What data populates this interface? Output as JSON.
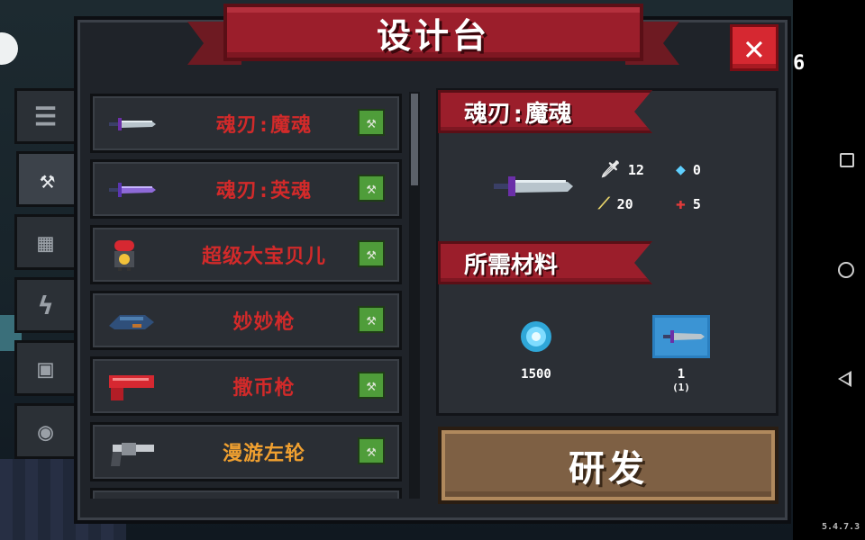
{
  "title": "设计台",
  "close_label": "✕",
  "gem_count": "6",
  "version": "5.4.7.3",
  "colors": {
    "name_red": "#d22a2a",
    "name_orange": "#f0a030",
    "ribbon": "#9b1e2b",
    "button": "#7e6044"
  },
  "side_tabs": [
    {
      "icon": "list-icon",
      "glyph": "☰"
    },
    {
      "icon": "weapon-tab-icon",
      "glyph": "⚒"
    },
    {
      "icon": "armor-tab-icon",
      "glyph": "▦"
    },
    {
      "icon": "lightning-tab-icon",
      "glyph": "ϟ"
    },
    {
      "icon": "items-tab-icon",
      "glyph": "▣"
    },
    {
      "icon": "pet-tab-icon",
      "glyph": "◉"
    }
  ],
  "weapon_list": [
    {
      "name": "魂刃:魔魂",
      "icon": "soul-blade-demon-icon",
      "craft_icon": "hammer-icon"
    },
    {
      "name": "魂刃:英魂",
      "icon": "soul-blade-hero-icon",
      "craft_icon": "hammer-icon"
    },
    {
      "name": "超级大宝贝儿",
      "icon": "big-baby-bomb-icon",
      "craft_icon": "hammer-icon"
    },
    {
      "name": "妙妙枪",
      "icon": "wonder-gun-icon",
      "craft_icon": "hammer-icon"
    },
    {
      "name": "撒币枪",
      "icon": "coin-gun-icon",
      "craft_icon": "hammer-icon"
    },
    {
      "name": "漫游左轮",
      "icon": "revolver-icon",
      "craft_icon": "hammer-icon"
    }
  ],
  "detail": {
    "weapon_name": "魂刃:魔魂",
    "weapon_icon": "soul-blade-demon-icon",
    "stats": {
      "damage": "12",
      "energy": "0",
      "crit": "20",
      "accuracy": "5"
    },
    "materials_title": "所需材料",
    "materials": [
      {
        "icon": "blue-gem-icon",
        "value": "1500"
      },
      {
        "icon": "blueprint-icon",
        "value": "1",
        "sub": "(1)"
      }
    ]
  },
  "research_label": "研发"
}
